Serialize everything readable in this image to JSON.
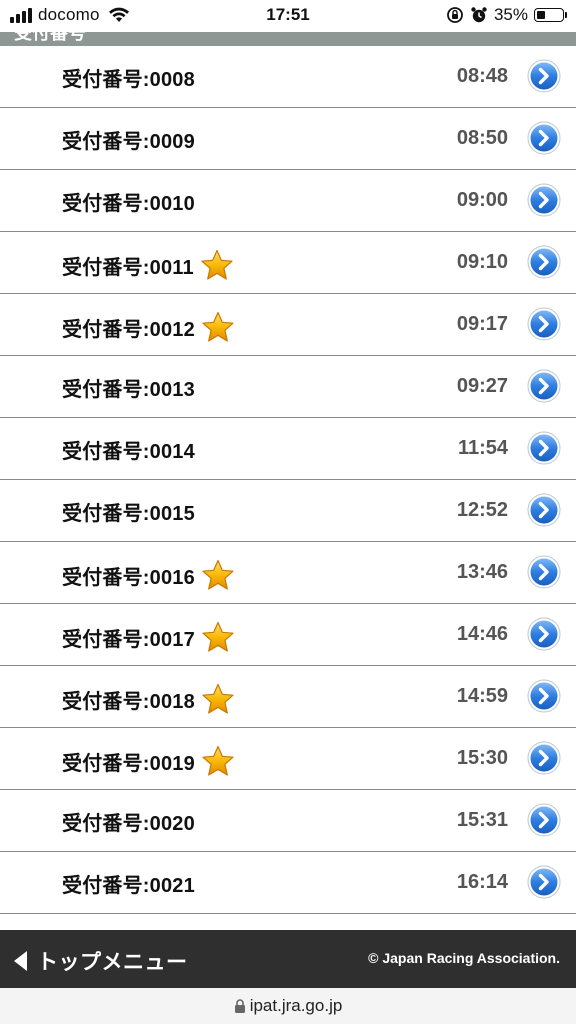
{
  "status_bar": {
    "carrier": "docomo",
    "time": "17:51",
    "battery_percent": "35%",
    "battery_level": 0.35
  },
  "section_header": {
    "title": "受付番号"
  },
  "rows": [
    {
      "label": "受付番号:0008",
      "time": "08:48",
      "starred": false
    },
    {
      "label": "受付番号:0009",
      "time": "08:50",
      "starred": false
    },
    {
      "label": "受付番号:0010",
      "time": "09:00",
      "starred": false
    },
    {
      "label": "受付番号:0011",
      "time": "09:10",
      "starred": true
    },
    {
      "label": "受付番号:0012",
      "time": "09:17",
      "starred": true
    },
    {
      "label": "受付番号:0013",
      "time": "09:27",
      "starred": false
    },
    {
      "label": "受付番号:0014",
      "time": "11:54",
      "starred": false
    },
    {
      "label": "受付番号:0015",
      "time": "12:52",
      "starred": false
    },
    {
      "label": "受付番号:0016",
      "time": "13:46",
      "starred": true
    },
    {
      "label": "受付番号:0017",
      "time": "14:46",
      "starred": true
    },
    {
      "label": "受付番号:0018",
      "time": "14:59",
      "starred": true
    },
    {
      "label": "受付番号:0019",
      "time": "15:30",
      "starred": true
    },
    {
      "label": "受付番号:0020",
      "time": "15:31",
      "starred": false
    },
    {
      "label": "受付番号:0021",
      "time": "16:14",
      "starred": false
    }
  ],
  "footer": {
    "top_menu_label": "トップメニュー",
    "copyright": "© Japan Racing Association."
  },
  "browser": {
    "url": "ipat.jra.go.jp"
  },
  "icons": {
    "star": "star-icon",
    "row_action": "chevron-right-circle-icon",
    "lock": "lock-icon"
  },
  "colors": {
    "accent_blue": "#2f7ee0",
    "star_gold": "#f7b500",
    "footer_bg": "#2f2f2f",
    "header_strip": "#8f9795"
  }
}
